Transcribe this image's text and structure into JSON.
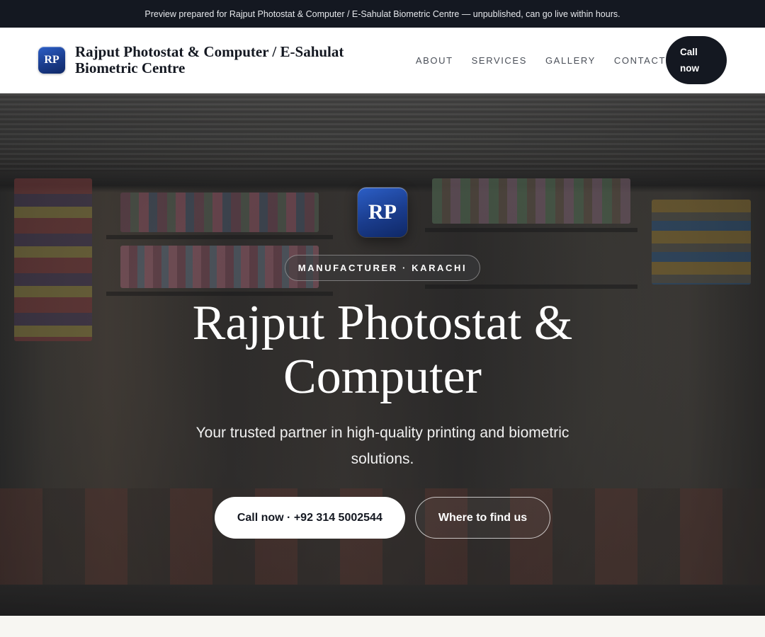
{
  "preview_bar": {
    "text": "Preview prepared for Rajput Photostat & Computer / E-Sahulat Biometric Centre — unpublished, can go live within hours."
  },
  "header": {
    "logo_text": "RP",
    "brand_name": "Rajput Photostat & Computer / E-Sahulat Biometric Centre",
    "nav": [
      {
        "label": "ABOUT"
      },
      {
        "label": "SERVICES"
      },
      {
        "label": "GALLERY"
      },
      {
        "label": "CONTACT"
      }
    ],
    "call_button": "Call now"
  },
  "hero": {
    "logo_text": "RP",
    "badge": "MANUFACTURER · KARACHI",
    "title": "Rajput Photostat & Computer",
    "subtitle": "Your trusted partner in high-quality printing and biometric solutions.",
    "primary_button": "Call now · +92 314 5002544",
    "secondary_button": "Where to find us",
    "background_image": "shop-storefront-photo"
  },
  "colors": {
    "dark": "#141821",
    "accent_blue": "#1a3c8c",
    "page_bg": "#f7f6f2"
  }
}
